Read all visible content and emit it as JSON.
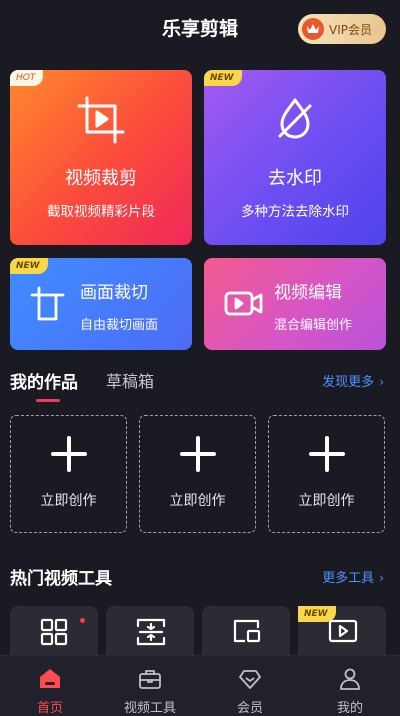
{
  "app": {
    "title": "乐享剪辑"
  },
  "vip": {
    "label": "VIP会员",
    "icon": "crown-icon"
  },
  "features": {
    "crop": {
      "tag": "HOT",
      "title": "视频裁剪",
      "subtitle": "截取视频精彩片段",
      "icon": "crop-play-icon"
    },
    "watermark": {
      "tag": "NEW",
      "title": "去水印",
      "subtitle": "多种方法去除水印",
      "icon": "eraser-icon"
    },
    "frame": {
      "tag": "NEW",
      "title": "画面裁切",
      "subtitle": "自由裁切画面",
      "icon": "page-crop-icon"
    },
    "edit": {
      "title": "视频编辑",
      "subtitle": "混合编辑创作",
      "icon": "video-camera-icon"
    }
  },
  "tabs": {
    "items": [
      {
        "label": "我的作品",
        "active": true
      },
      {
        "label": "草稿箱",
        "active": false
      }
    ],
    "more": "发现更多"
  },
  "works": {
    "slots": [
      {
        "label": "立即创作"
      },
      {
        "label": "立即创作"
      },
      {
        "label": "立即创作"
      }
    ]
  },
  "tools": {
    "title": "热门视频工具",
    "more": "更多工具",
    "items": [
      {
        "icon": "grid-icon",
        "badge": "red-dot"
      },
      {
        "icon": "compress-icon"
      },
      {
        "icon": "picture-in-picture-icon"
      },
      {
        "icon": "play-square-icon",
        "tag": "NEW"
      }
    ]
  },
  "nav": {
    "items": [
      {
        "label": "首页",
        "icon": "home-icon",
        "active": true
      },
      {
        "label": "视频工具",
        "icon": "toolbox-icon",
        "active": false
      },
      {
        "label": "会员",
        "icon": "diamond-icon",
        "active": false
      },
      {
        "label": "我的",
        "icon": "user-icon",
        "active": false
      }
    ]
  },
  "colors": {
    "background": "#1a1b22",
    "accent": "#ff4a4f",
    "link": "#4f8fff"
  }
}
